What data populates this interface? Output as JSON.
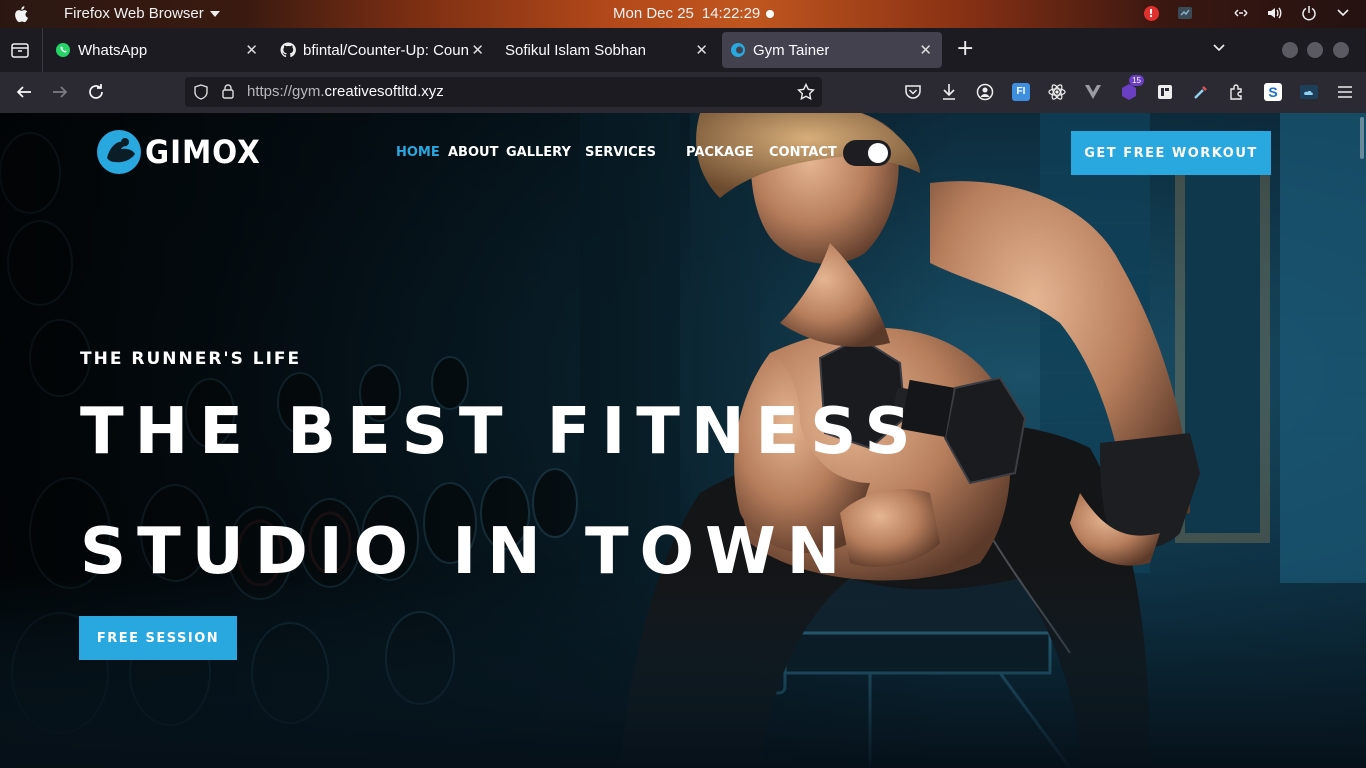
{
  "os": {
    "app_name": "Firefox Web Browser",
    "date": "Mon Dec 25",
    "time": "14:22:29",
    "alert": "!"
  },
  "browser": {
    "tabs": [
      {
        "label": "WhatsApp",
        "icon": "whatsapp-icon",
        "active": false
      },
      {
        "label": "bfintal/Counter-Up: Coun",
        "icon": "github-icon",
        "active": false
      },
      {
        "label": "Sofikul Islam Sobhan",
        "icon": "",
        "active": false
      },
      {
        "label": "Gym Tainer",
        "icon": "site-favicon",
        "active": true
      }
    ],
    "url_prefix": "https://gym.",
    "url_host": "creativesoftltd.xyz",
    "extension_badge": "15",
    "ext_fi_label": "FI",
    "ext_s_label": "S"
  },
  "site": {
    "logo_text": "GIMOX",
    "menu": [
      "HOME",
      "ABOUT",
      "GALLERY",
      "SERVICES",
      "PACKAGE",
      "CONTACT"
    ],
    "menu_active": "HOME",
    "cta_top": "GET FREE WORKOUT",
    "eyebrow": "THE RUNNER'S LIFE",
    "headline_line1": "THE BEST FITNESS",
    "headline_line2": "STUDIO IN TOWN",
    "cta_hero": "FREE SESSION",
    "accent_color": "#29a7df"
  }
}
